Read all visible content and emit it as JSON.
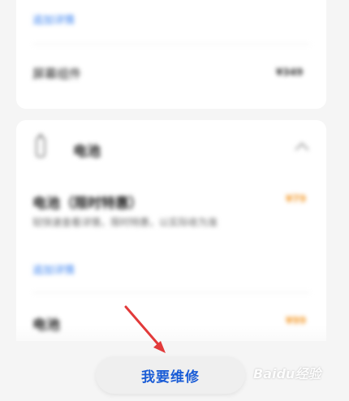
{
  "card1": {
    "link_label": "追加详情",
    "row_title": "屏幕组件",
    "row_price": "¥349"
  },
  "card2": {
    "section_title": "电池",
    "item1": {
      "title": "电池（限时特惠）",
      "price": "¥79",
      "description": "较快速查看详情，限时特惠，以实际收为准",
      "link_label": "追加详情"
    },
    "item2": {
      "title": "电池",
      "price": "¥99"
    }
  },
  "repair_button_label": "我要维修",
  "watermark": "Baidu经验",
  "colors": {
    "link_blue": "#3a82f0",
    "price_orange": "#f39a2c",
    "button_text": "#1a5cd6",
    "arrow_red": "#e23a3a"
  }
}
